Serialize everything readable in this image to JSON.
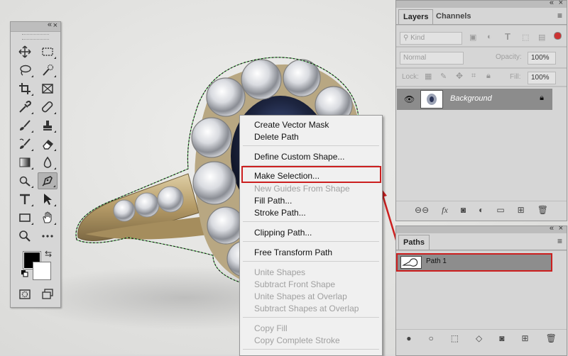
{
  "tools_panel": {
    "tools": [
      {
        "name": "move-icon"
      },
      {
        "name": "marquee-icon"
      },
      {
        "name": "lasso-icon"
      },
      {
        "name": "quick-selection-icon"
      },
      {
        "name": "crop-icon"
      },
      {
        "name": "frame-icon"
      },
      {
        "name": "eyedropper-icon"
      },
      {
        "name": "healing-brush-icon"
      },
      {
        "name": "brush-icon"
      },
      {
        "name": "clone-stamp-icon"
      },
      {
        "name": "history-brush-icon"
      },
      {
        "name": "eraser-icon"
      },
      {
        "name": "gradient-icon"
      },
      {
        "name": "blur-icon"
      },
      {
        "name": "dodge-icon"
      },
      {
        "name": "pen-icon"
      },
      {
        "name": "type-icon"
      },
      {
        "name": "path-selection-icon"
      },
      {
        "name": "rectangle-icon"
      },
      {
        "name": "hand-icon"
      },
      {
        "name": "zoom-icon"
      },
      {
        "name": "more-tools-icon"
      }
    ],
    "active_tool": "pen-icon",
    "foreground_color": "#000000",
    "background_color": "#ffffff"
  },
  "layers_panel": {
    "tabs": [
      "Layers",
      "Channels"
    ],
    "filter_placeholder": "Kind",
    "blend_mode": "Normal",
    "opacity_label": "Opacity:",
    "opacity_value": "100%",
    "lock_label": "Lock:",
    "fill_label": "Fill:",
    "fill_value": "100%",
    "layer_name": "Background"
  },
  "paths_panel": {
    "tab": "Paths",
    "path_name": "Path 1"
  },
  "context_menu": {
    "items": [
      {
        "label": "Create Vector Mask",
        "enabled": true
      },
      {
        "label": "Delete Path",
        "enabled": true
      },
      {
        "label": "Define Custom Shape...",
        "enabled": true
      },
      {
        "label": "Make Selection...",
        "enabled": true,
        "highlighted": true
      },
      {
        "label": "New Guides From Shape",
        "enabled": false
      },
      {
        "label": "Fill Path...",
        "enabled": true
      },
      {
        "label": "Stroke Path...",
        "enabled": true
      },
      {
        "label": "Clipping Path...",
        "enabled": true
      },
      {
        "label": "Free Transform Path",
        "enabled": true
      },
      {
        "label": "Unite Shapes",
        "enabled": false
      },
      {
        "label": "Subtract Front Shape",
        "enabled": false
      },
      {
        "label": "Unite Shapes at Overlap",
        "enabled": false
      },
      {
        "label": "Subtract Shapes at Overlap",
        "enabled": false
      },
      {
        "label": "Copy Fill",
        "enabled": false
      },
      {
        "label": "Copy Complete Stroke",
        "enabled": false
      }
    ]
  },
  "colors": {
    "highlight_red": "#cc1f1f",
    "panel_gray": "#d6d6d6",
    "selected_row": "#8c8c8c"
  }
}
